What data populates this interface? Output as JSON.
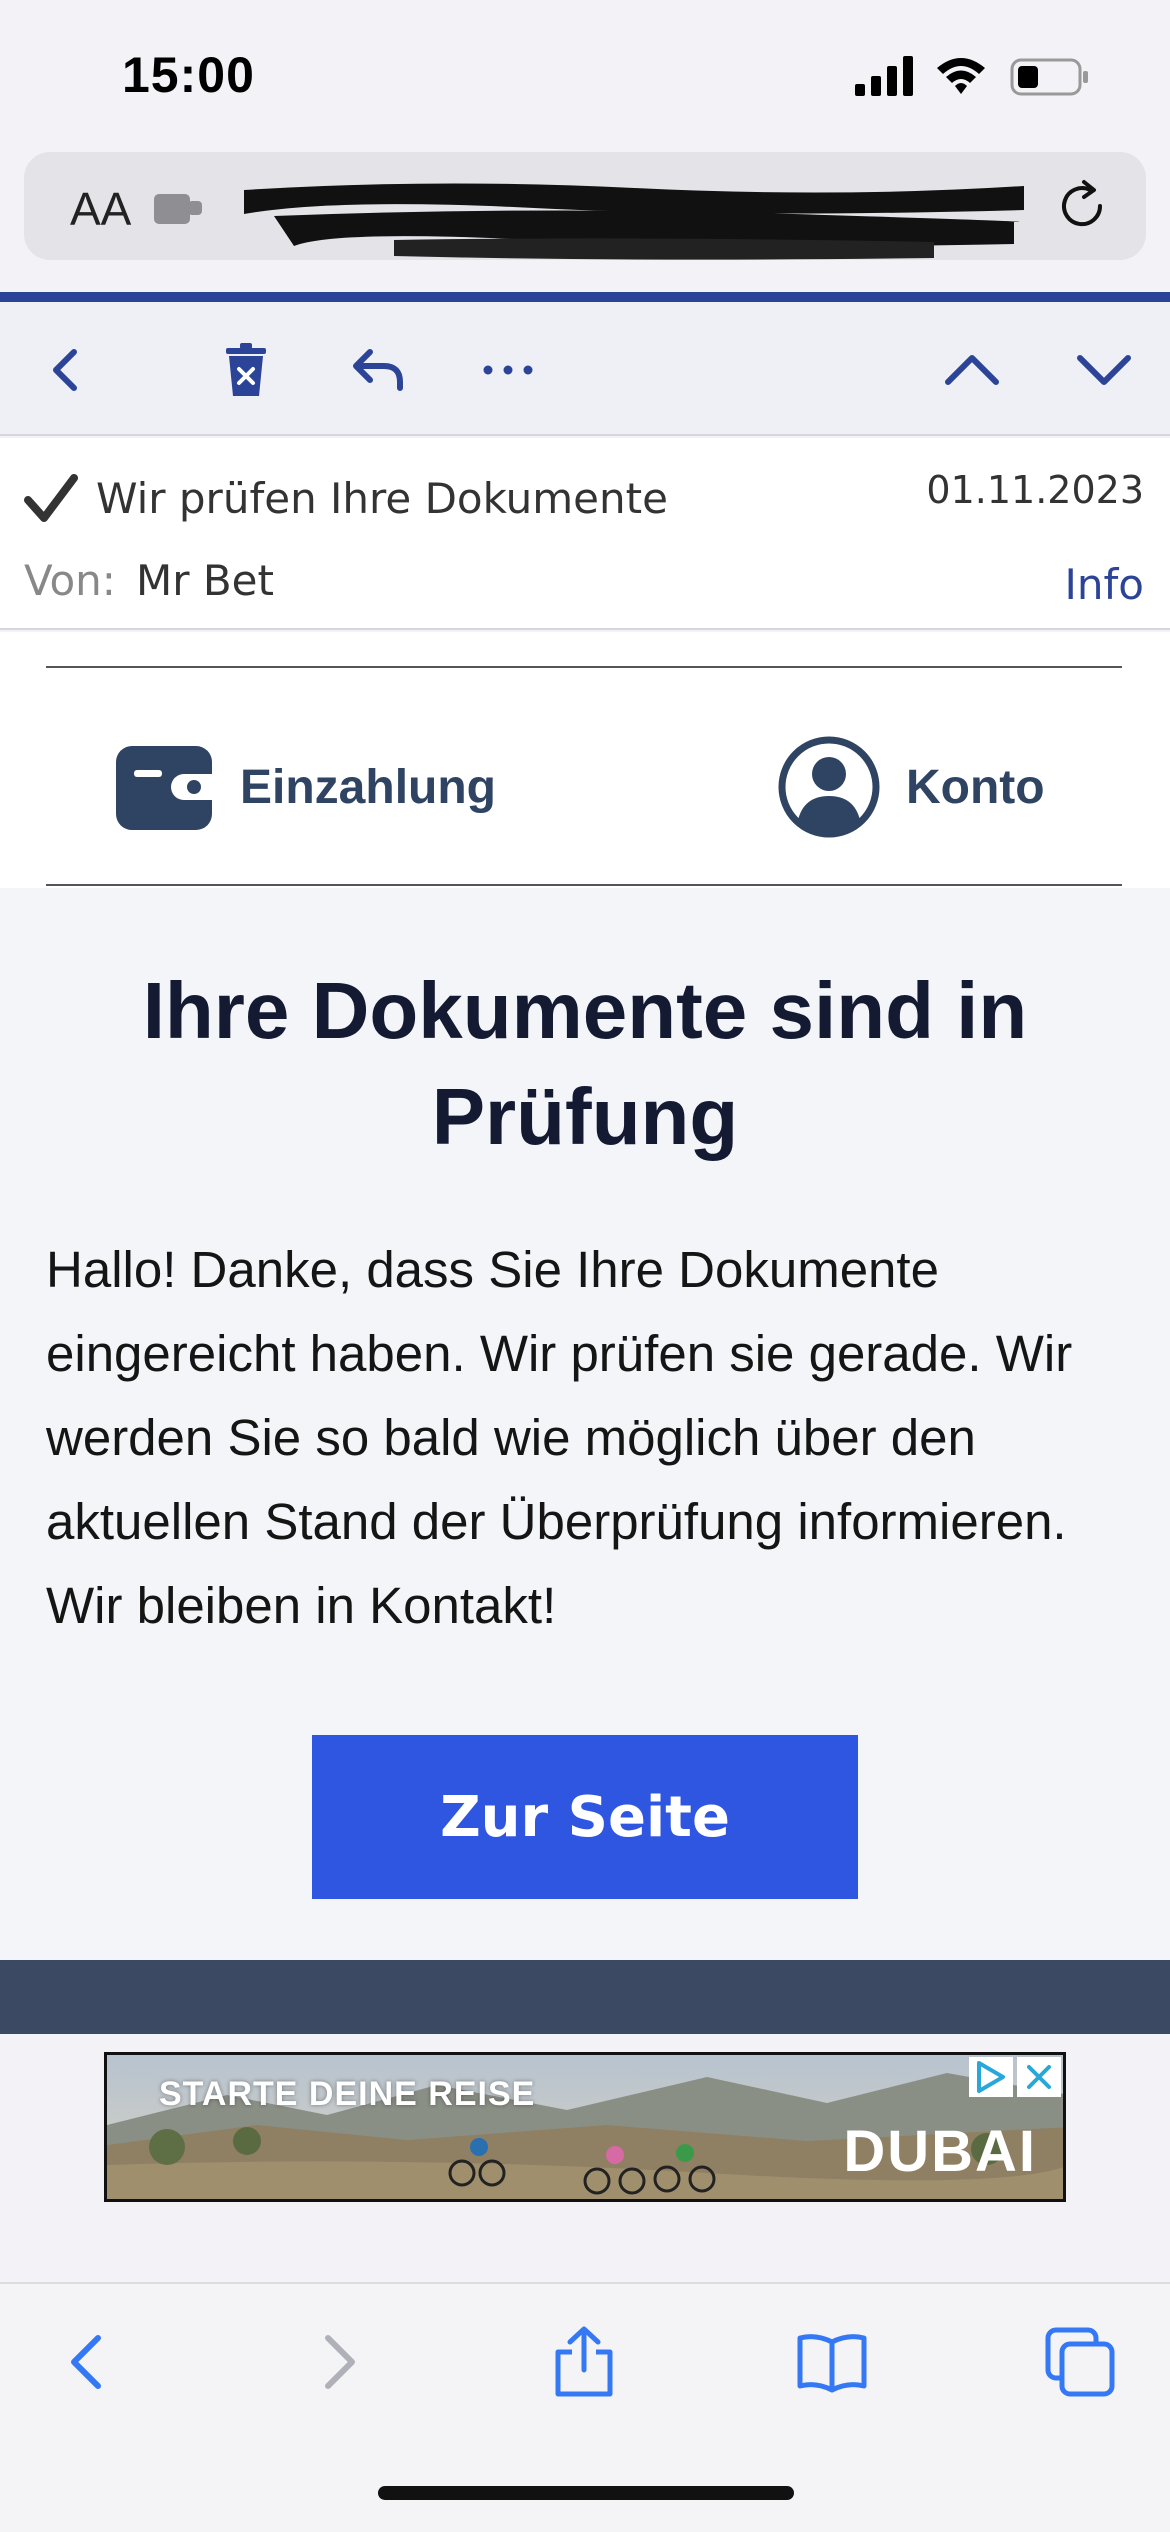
{
  "status_bar": {
    "time": "15:00"
  },
  "browser": {
    "text_size_label": "AA",
    "url": "",
    "bottom_toolbar": [
      "back",
      "forward",
      "share",
      "bookmarks",
      "tabs"
    ]
  },
  "mail": {
    "toolbar": [
      "back",
      "delete",
      "reply",
      "more",
      "previous",
      "next"
    ],
    "subject": "Wir prüfen Ihre Dokumente",
    "date": "01.11.2023",
    "from_label": "Von:",
    "from_value": "Mr Bet",
    "info_link": "Info"
  },
  "email": {
    "nav": [
      {
        "label": "Einzahlung",
        "icon": "wallet-icon"
      },
      {
        "label": "Konto",
        "icon": "account-icon"
      }
    ],
    "title": "Ihre Dokumente sind in Prüfung",
    "body": "Hallo! Danke, dass Sie Ihre Dokumente eingereicht haben. Wir prüfen sie gerade. Wir werden Sie so bald wie möglich über den aktuellen Stand der Überprüfung informieren. Wir bleiben in Kontakt!",
    "cta": "Zur Seite"
  },
  "ad": {
    "headline": "STARTE DEINE REISE",
    "brand": "DUBAI"
  },
  "colors": {
    "accent": "#2b4497",
    "nav_text": "#2f4463",
    "cta_bg": "#2f56e0",
    "footer_band": "#3b4a62",
    "ios_blue": "#3478f6"
  }
}
